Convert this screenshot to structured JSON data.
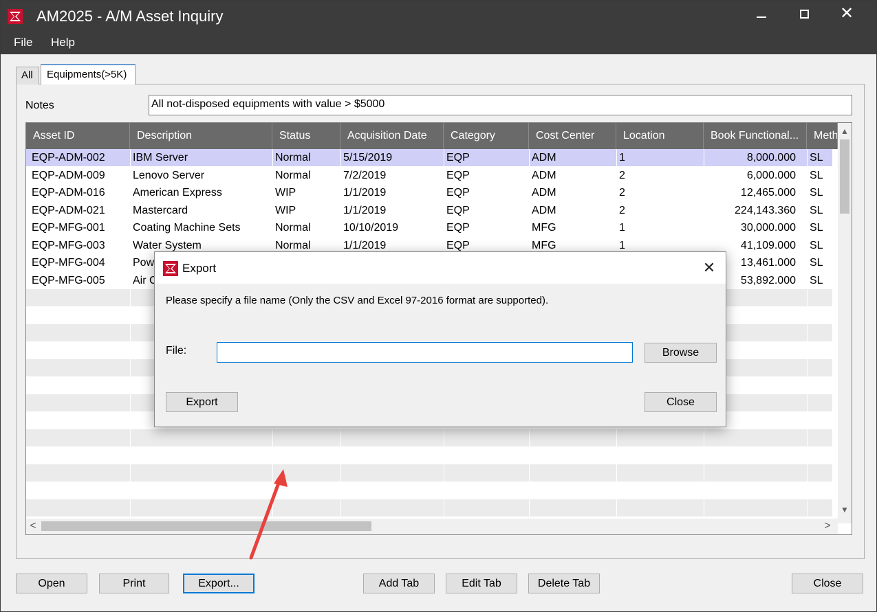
{
  "window": {
    "title": "AM2025 - A/M Asset Inquiry",
    "controls": {
      "minimize": "–",
      "maximize": "□",
      "close": "✕"
    }
  },
  "menu": {
    "items": [
      "File",
      "Help"
    ]
  },
  "tabs": [
    {
      "label": "All",
      "active": false
    },
    {
      "label": "Equipments(>5K)",
      "active": true
    }
  ],
  "notes": {
    "label": "Notes",
    "value": "All not-disposed equipments with value > $5000"
  },
  "grid": {
    "columns": [
      "Asset ID",
      "Description",
      "Status",
      "Acquisition Date",
      "Category",
      "Cost Center",
      "Location",
      "Book Functional...",
      "Meth"
    ],
    "rows": [
      [
        "EQP-ADM-002",
        "IBM Server",
        "Normal",
        "5/15/2019",
        "EQP",
        "ADM",
        "1",
        "8,000.000",
        "SL"
      ],
      [
        "EQP-ADM-009",
        "Lenovo Server",
        "Normal",
        "7/2/2019",
        "EQP",
        "ADM",
        "2",
        "6,000.000",
        "SL"
      ],
      [
        "EQP-ADM-016",
        "American Express",
        "WIP",
        "1/1/2019",
        "EQP",
        "ADM",
        "2",
        "12,465.000",
        "SL"
      ],
      [
        "EQP-ADM-021",
        "Mastercard",
        "WIP",
        "1/1/2019",
        "EQP",
        "ADM",
        "2",
        "224,143.360",
        "SL"
      ],
      [
        "EQP-MFG-001",
        "Coating Machine Sets",
        "Normal",
        "10/10/2019",
        "EQP",
        "MFG",
        "1",
        "30,000.000",
        "SL"
      ],
      [
        "EQP-MFG-003",
        "Water System",
        "Normal",
        "1/1/2019",
        "EQP",
        "MFG",
        "1",
        "41,109.000",
        "SL"
      ],
      [
        "EQP-MFG-004",
        "Pow",
        "",
        "",
        "",
        "",
        "",
        "13,461.000",
        "SL"
      ],
      [
        "EQP-MFG-005",
        "Air C",
        "",
        "",
        "",
        "",
        "",
        "53,892.000",
        "SL"
      ]
    ],
    "selected_row": 0,
    "scroll": {
      "up": "▲",
      "down": "▼",
      "left": "<",
      "right": ">"
    }
  },
  "buttons": {
    "open": "Open",
    "print": "Print",
    "export": "Export...",
    "add_tab": "Add Tab",
    "edit_tab": "Edit Tab",
    "delete_tab": "Delete Tab",
    "close": "Close"
  },
  "dialog": {
    "title": "Export",
    "close_glyph": "✕",
    "message": "Please specify a file name (Only the CSV and Excel 97-2016 format are supported).",
    "file_label": "File:",
    "file_value": "",
    "browse": "Browse",
    "export": "Export",
    "close": "Close"
  },
  "colors": {
    "titlebar": "#3c3c3c",
    "grid_header": "#6a6a6a",
    "selected_row": "#cfcff7",
    "focus_border": "#0078d7",
    "annotation_arrow": "#e8413c"
  }
}
